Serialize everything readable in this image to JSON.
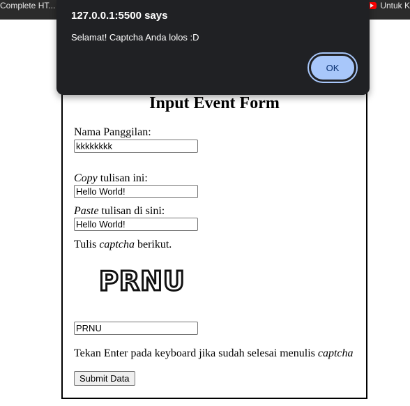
{
  "browser": {
    "bookmark_left": "Complete HT...",
    "bookmark_right": "Untuk K"
  },
  "alert": {
    "title": "127.0.0.1:5500 says",
    "message": "Selamat! Captcha Anda lolos :D",
    "ok_label": "OK"
  },
  "form": {
    "title": "Input Event Form",
    "nickname_label": "Nama Panggilan:",
    "nickname_value": "kkkkkkkk",
    "copy_label_em": "Copy",
    "copy_label_rest": " tulisan ini:",
    "copy_value": "Hello World!",
    "paste_label_em": "Paste",
    "paste_label_rest": " tulisan di sini:",
    "paste_value": "Hello World!",
    "captcha_prompt_pre": "Tulis ",
    "captcha_prompt_em": "captcha",
    "captcha_prompt_post": " berikut.",
    "captcha_image_text": "PRNU",
    "captcha_value": "PRNU",
    "enter_hint_pre": "Tekan Enter pada keyboard jika sudah selesai menulis ",
    "enter_hint_em": "captcha",
    "submit_label": "Submit Data"
  },
  "colors": {
    "alert_bg": "#202124",
    "ok_button": "#a8c7fa",
    "bookmark_bar": "#2b2b2b"
  }
}
